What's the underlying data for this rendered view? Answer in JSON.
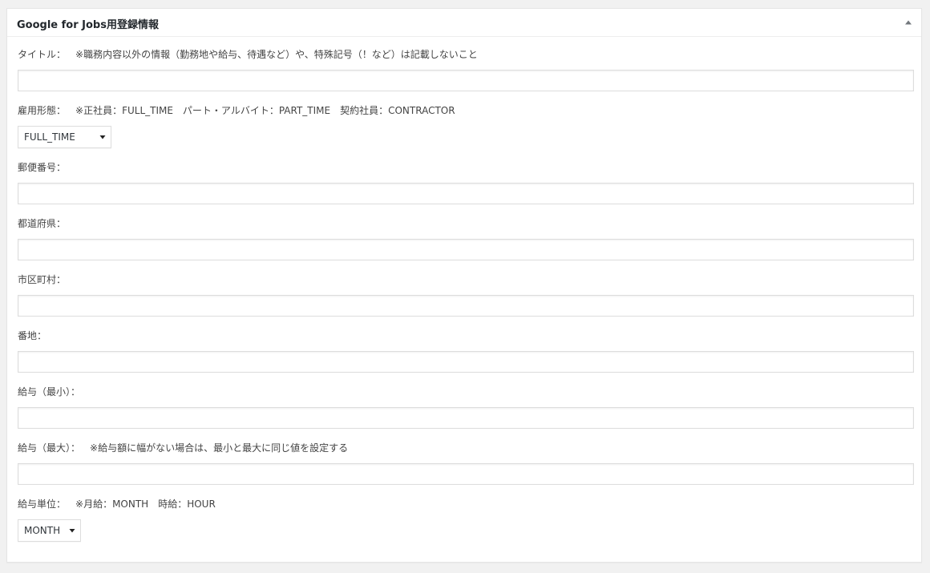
{
  "metabox": {
    "title": "Google for Jobs用登録情報",
    "toggle_icon": "triangle-up-icon"
  },
  "fields": [
    {
      "label": "タイトル：",
      "note": "※職務内容以外の情報（勤務地や給与、待遇など）や、特殊記号（！など）は記載しないこと",
      "value": ""
    },
    {
      "label": "雇用形態：",
      "note": "※正社員：FULL_TIME　パート・アルバイト：PART_TIME　契約社員：CONTRACTOR",
      "selected": "FULL_TIME"
    },
    {
      "label": "郵便番号：",
      "value": ""
    },
    {
      "label": "都道府県：",
      "value": ""
    },
    {
      "label": "市区町村：",
      "value": ""
    },
    {
      "label": "番地：",
      "value": ""
    },
    {
      "label": "給与（最小）：",
      "value": ""
    },
    {
      "label": "給与（最大）：",
      "note": "※給与額に幅がない場合は、最小と最大に同じ値を設定する",
      "value": ""
    },
    {
      "label": "給与単位：",
      "note": "※月給：MONTH　時給：HOUR",
      "selected": "MONTH"
    }
  ]
}
